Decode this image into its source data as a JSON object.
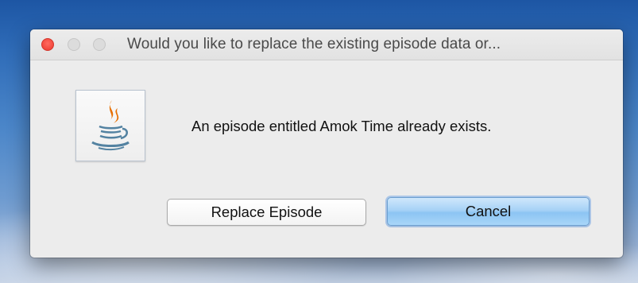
{
  "dialog": {
    "title": "Would you like to replace the existing episode data or...",
    "message": "An episode entitled Amok Time already exists.",
    "icon": "java-icon",
    "buttons": {
      "replace_label": "Replace Episode",
      "cancel_label": "Cancel"
    },
    "window_controls": [
      "close",
      "minimize",
      "zoom"
    ]
  },
  "colors": {
    "close_button": "#f2473c",
    "default_button": "#a7d2f6",
    "java_flame": "#e76f00",
    "java_cup": "#5382a1"
  }
}
